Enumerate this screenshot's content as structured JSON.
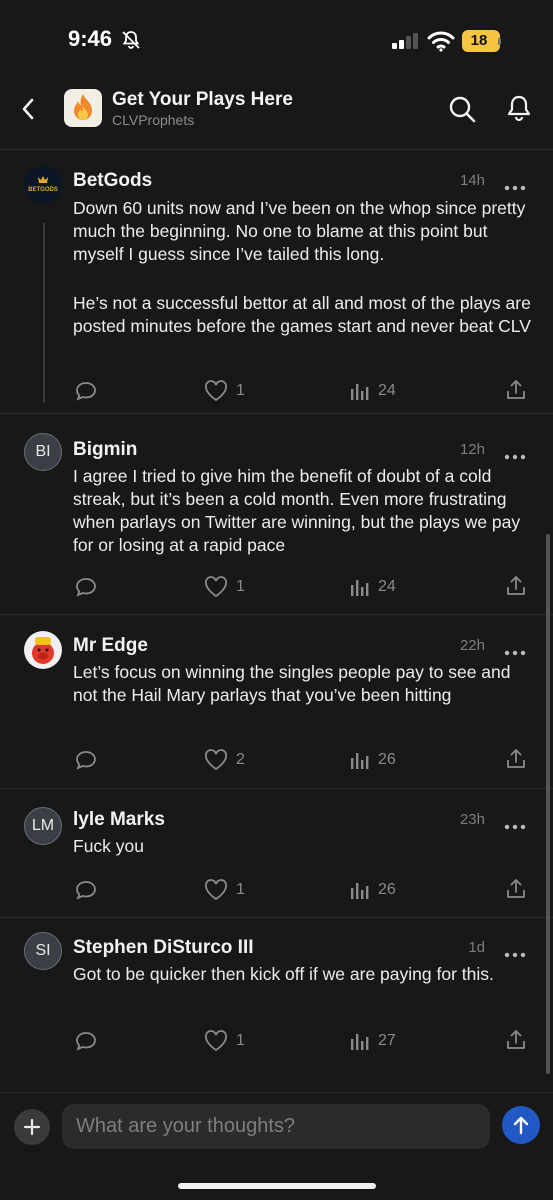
{
  "status_bar": {
    "time": "9:46",
    "battery": "18"
  },
  "header": {
    "title": "Get Your Plays Here",
    "subtitle": "CLVProphets"
  },
  "posts": [
    {
      "author": "BetGods",
      "avatar_text": "BETGODS",
      "time": "14h",
      "paragraphs": [
        "Down 60 units now and I’ve been on the whop since pretty much the beginning. No one to blame at this point but myself I guess since I’ve tailed this long.",
        "He’s not a successful bettor at all and most of the plays are posted minutes before the games start and never beat CLV"
      ],
      "likes": "1",
      "views": "24"
    },
    {
      "author": "Bigmin",
      "initials": "BI",
      "time": "12h",
      "text": "I agree I tried to give him the benefit of doubt of a cold streak, but it’s been a cold month. Even more frustrating when parlays on Twitter are winning, but the plays we pay for or losing at a rapid pace",
      "likes": "1",
      "views": "24"
    },
    {
      "author": "Mr Edge",
      "time": "22h",
      "text": "Let’s focus on winning the singles people pay to see and not the Hail Mary parlays that you’ve been hitting",
      "likes": "2",
      "views": "26"
    },
    {
      "author": "lyle Marks",
      "initials": "LM",
      "time": "23h",
      "text": "Fuck you",
      "likes": "1",
      "views": "26"
    },
    {
      "author": "Stephen DiSturco III",
      "initials": "SI",
      "time": "1d",
      "text": "Got to be quicker then kick off if we are paying for this.",
      "likes": "1",
      "views": "27"
    }
  ],
  "composer": {
    "placeholder": "What are your thoughts?"
  },
  "colors": {
    "background": "#181818",
    "send_button": "#2258c4",
    "battery": "#f5c542"
  }
}
